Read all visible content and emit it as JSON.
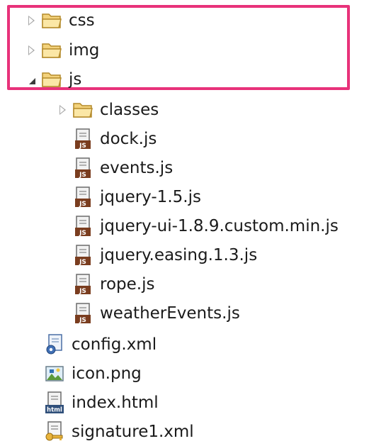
{
  "colors": {
    "highlight_border": "#e8327a",
    "folder": "#e6b84a",
    "js_badge": "#7a3d1f"
  },
  "tree": {
    "folders_top": [
      {
        "label": "css",
        "state": "collapsed",
        "icon": "folder-icon"
      },
      {
        "label": "img",
        "state": "collapsed",
        "icon": "folder-icon"
      },
      {
        "label": "js",
        "state": "expanded",
        "icon": "folder-open-icon"
      }
    ],
    "js_children": [
      {
        "label": "classes",
        "state": "collapsed",
        "icon": "folder-icon"
      },
      {
        "label": "dock.js",
        "icon": "javascript-file-icon"
      },
      {
        "label": "events.js",
        "icon": "javascript-file-icon"
      },
      {
        "label": "jquery-1.5.js",
        "icon": "javascript-file-icon"
      },
      {
        "label": "jquery-ui-1.8.9.custom.min.js",
        "icon": "javascript-file-icon"
      },
      {
        "label": "jquery.easing.1.3.js",
        "icon": "javascript-file-icon"
      },
      {
        "label": "rope.js",
        "icon": "javascript-file-icon"
      },
      {
        "label": "weatherEvents.js",
        "icon": "javascript-file-icon"
      }
    ],
    "root_files": [
      {
        "label": "config.xml",
        "icon": "config-xml-file-icon"
      },
      {
        "label": "icon.png",
        "icon": "image-file-icon"
      },
      {
        "label": "index.html",
        "icon": "html-file-icon"
      },
      {
        "label": "signature1.xml",
        "icon": "signature-xml-file-icon"
      }
    ]
  }
}
